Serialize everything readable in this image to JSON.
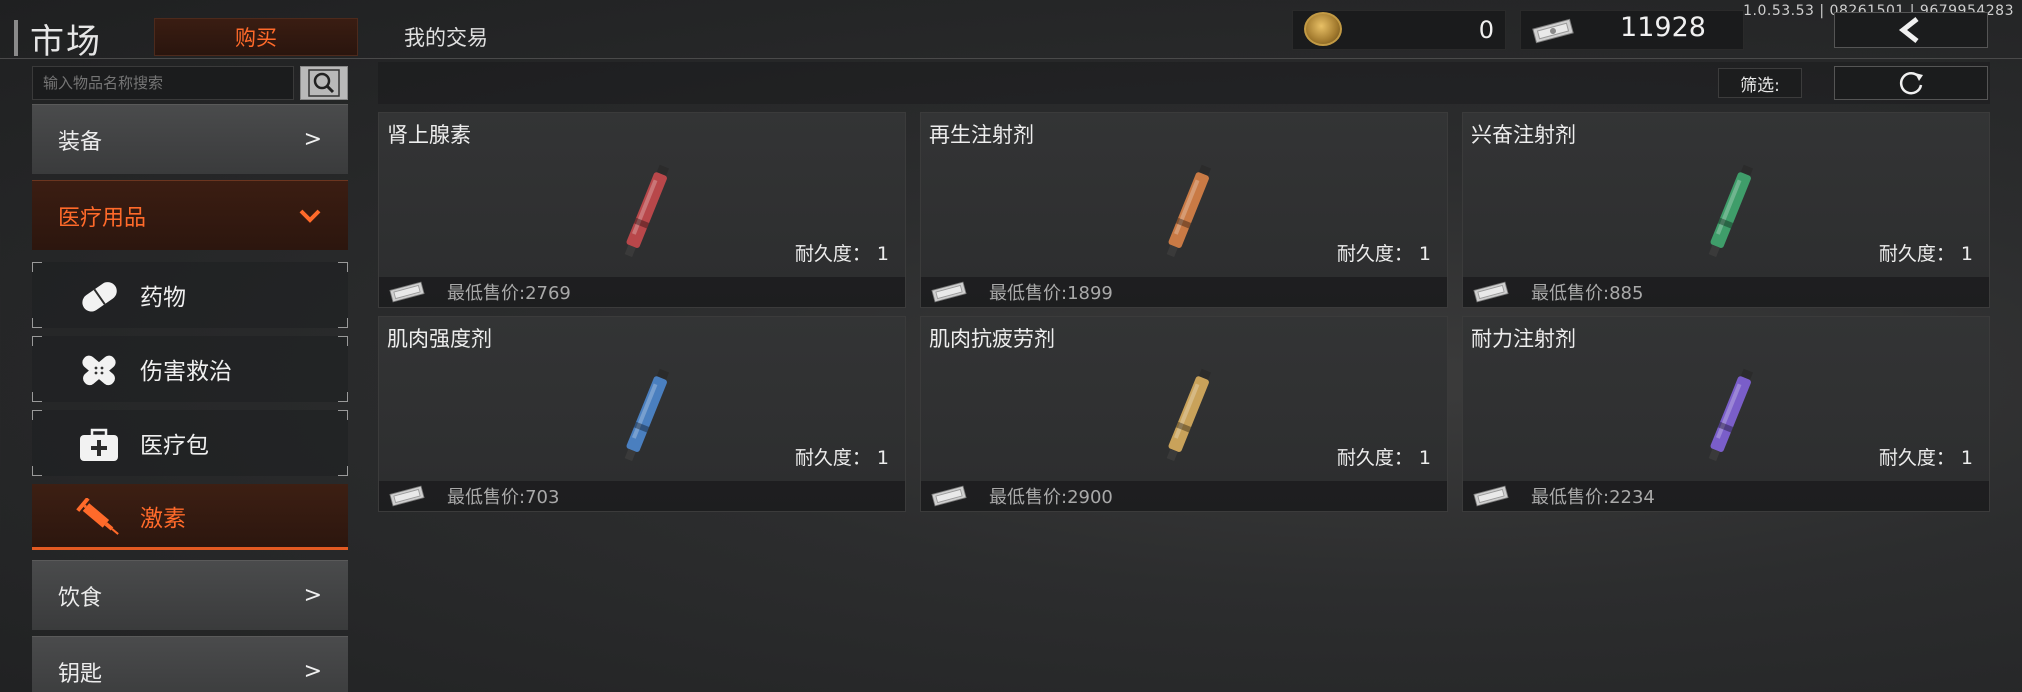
{
  "header": {
    "title": "市场",
    "tab_buy": "购买",
    "tab_trade": "我的交易",
    "coins": "0",
    "cash": "11928",
    "version": "1.0.53.53 | 08261501 | 9679954283"
  },
  "sidebar": {
    "search_placeholder": "输入物品名称搜索",
    "categories": [
      {
        "label": "装备",
        "state": "collapsed"
      },
      {
        "label": "医疗用品",
        "state": "expanded"
      },
      {
        "label": "饮食",
        "state": "collapsed"
      },
      {
        "label": "钥匙",
        "state": "collapsed"
      }
    ],
    "subcategories": [
      {
        "label": "药物",
        "icon": "pill-icon"
      },
      {
        "label": "伤害救治",
        "icon": "bandage-icon"
      },
      {
        "label": "医疗包",
        "icon": "medkit-icon"
      },
      {
        "label": "激素",
        "icon": "syringe-icon",
        "selected": true
      }
    ]
  },
  "toolbar": {
    "filter_label": "筛选:"
  },
  "items": [
    {
      "name": "肾上腺素",
      "durability": "耐久度： 1",
      "price": "最低售价:2769",
      "color": "#b8474a"
    },
    {
      "name": "再生注射剂",
      "durability": "耐久度： 1",
      "price": "最低售价:1899",
      "color": "#c97a45"
    },
    {
      "name": "兴奋注射剂",
      "durability": "耐久度： 1",
      "price": "最低售价:885",
      "color": "#3f9d6a"
    },
    {
      "name": "肌肉强度剂",
      "durability": "耐久度： 1",
      "price": "最低售价:703",
      "color": "#4a7fbf"
    },
    {
      "name": "肌肉抗疲劳剂",
      "durability": "耐久度： 1",
      "price": "最低售价:2900",
      "color": "#c9a25a"
    },
    {
      "name": "耐力注射剂",
      "durability": "耐久度： 1",
      "price": "最低售价:2234",
      "color": "#7a5ec9"
    }
  ],
  "colors": {
    "accent": "#ff6a2a",
    "panel": "#2f3031"
  }
}
